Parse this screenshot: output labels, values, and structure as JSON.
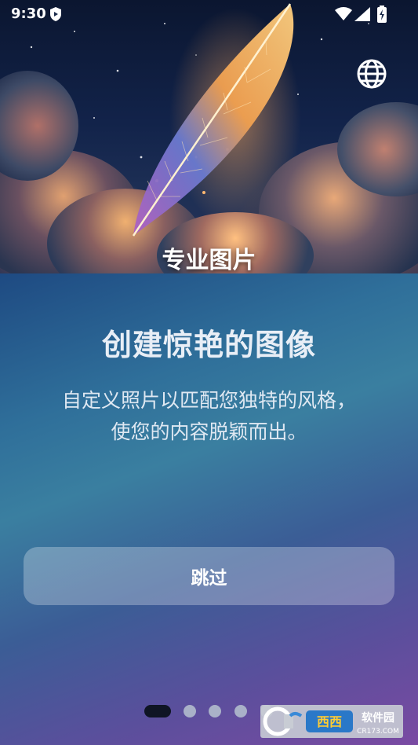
{
  "status_bar": {
    "time": "9:30",
    "icons": [
      "shield-icon",
      "wifi-icon",
      "signal-icon",
      "battery-charging-icon"
    ]
  },
  "header": {
    "language_icon": "globe-icon"
  },
  "hero": {
    "caption": "专业图片"
  },
  "onboarding": {
    "headline": "创建惊艳的图像",
    "description_line1": "自定义照片以匹配您独特的风格，",
    "description_line2": "使您的内容脱颖而出。",
    "skip_label": "跳过",
    "page_count": 5,
    "current_page": 1
  },
  "watermark": {
    "brand": "西西软件园",
    "url": "CR173.COM"
  },
  "colors": {
    "accent_dark": "#0f1524",
    "dot_inactive": "#a9b1c8",
    "panel_top": "#1e4a82",
    "panel_bottom": "#7a4aa2"
  }
}
